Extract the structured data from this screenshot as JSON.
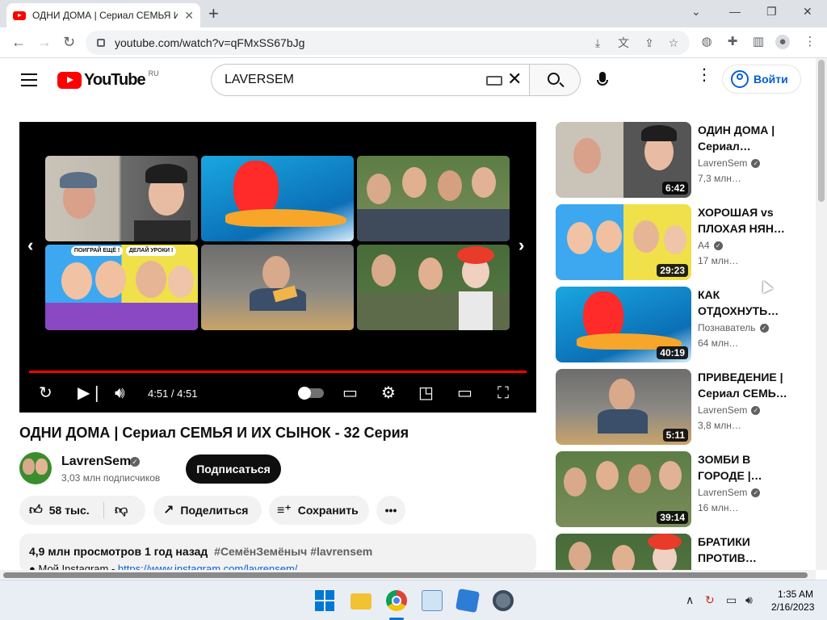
{
  "browser": {
    "tab_title": "ОДНИ ДОМА | Сериал СЕМЬЯ И",
    "url": "youtube.com/watch?v=qFMxSS67bJg"
  },
  "masthead": {
    "logo_text": "YouTube",
    "region": "RU",
    "search_query": "LAVERSEM",
    "signin_label": "Войти"
  },
  "player": {
    "time": "4:51 / 4:51",
    "progress_fraction": 1.0
  },
  "video": {
    "title": "ОДНИ ДОМА | Сериал СЕМЬЯ И ИХ СЫНОК - 32 Серия",
    "channel": "LavrenSem",
    "subscribers": "3,03 млн подписчиков",
    "subscribe_label": "Подписаться",
    "likes": "58 тыс.",
    "share_label": "Поделиться",
    "save_label": "Сохранить",
    "views_date": "4,9 млн просмотров  1 год назад",
    "tags": "#СемёнЗемёныч #lavrensem",
    "desc_line2_prefix": "● Мой Instagram  - ",
    "desc_line2_link": "https://www.instagram.com/lavrensem/"
  },
  "recommendations": [
    {
      "title": "ОДИН ДОМА | Сериал…",
      "channel": "LavrenSem",
      "views": "7,3 млн…",
      "duration": "6:42"
    },
    {
      "title": "ХОРОШАЯ vs ПЛОХАЯ НЯН…",
      "channel": "A4",
      "views": "17 млн…",
      "duration": "29:23"
    },
    {
      "title": "КАК ОТДОХНУТЬ…",
      "channel": "Познаватель",
      "views": "64 млн…",
      "duration": "40:19"
    },
    {
      "title": "ПРИВЕДЕНИЕ | Сериал СЕМЬ…",
      "channel": "LavrenSem",
      "views": "3,8 млн…",
      "duration": "5:11"
    },
    {
      "title": "ЗОМБИ В ГОРОДЕ |…",
      "channel": "LavrenSem",
      "views": "16 млн…",
      "duration": "39:14"
    },
    {
      "title": "БРАТИКИ ПРОТИВ…",
      "channel": "",
      "views": "",
      "duration": ""
    }
  ],
  "endscreen_labels": {
    "bubble_left": "ПОИГРАЙ ЕЩЁ !",
    "bubble_right": "ДЕЛАЙ УРОКИ !"
  },
  "taskbar": {
    "time": "1:35 AM",
    "date": "2/16/2023"
  },
  "colors": {
    "brand_red": "#ff0000",
    "link_blue": "#065fd4",
    "subscribe_bg": "#0f0f0f"
  }
}
